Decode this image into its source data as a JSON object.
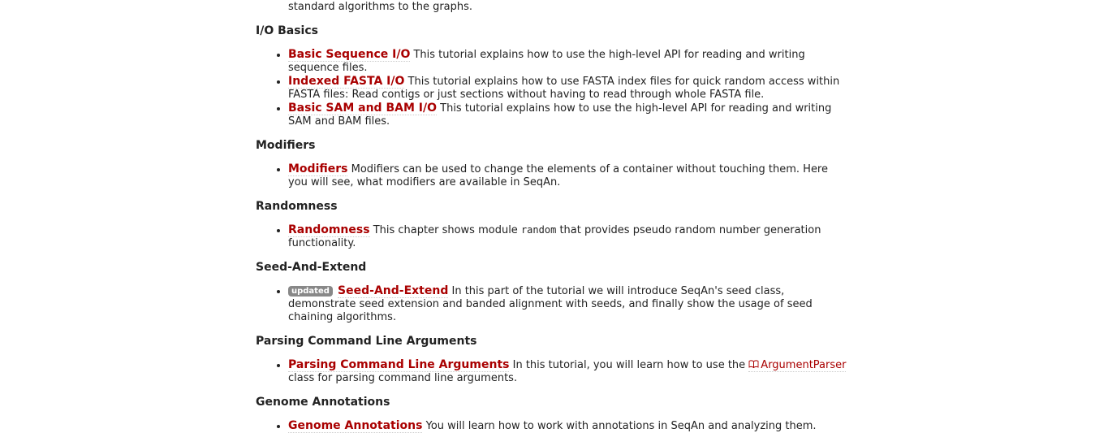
{
  "intro_text": "HMMs, how to store additional information for edges and vertices and last but not least how to apply standard algorithms to the graphs.",
  "sections": [
    {
      "heading": "I/O Basics",
      "items": [
        {
          "link": "Basic Sequence I/O",
          "text": "This tutorial explains how to use the high-level API for reading and writing sequence files."
        },
        {
          "link": "Indexed FASTA I/O",
          "text": "This tutorial explains how to use FASTA index files for quick random access within FASTA files: Read contigs or just sections without having to read through whole FASTA file."
        },
        {
          "link": "Basic SAM and BAM I/O",
          "text": "This tutorial explains how to use the high-level API for reading and writing SAM and BAM files."
        }
      ]
    },
    {
      "heading": "Modifiers",
      "items": [
        {
          "link": "Modifiers",
          "text": "Modifiers can be used to change the elements of a container without touching them. Here you will see, what modifiers are available in SeqAn."
        }
      ]
    },
    {
      "heading": "Randomness",
      "items": [
        {
          "link": "Randomness",
          "text_before": "This chapter shows module",
          "code": "random",
          "text_after": "that provides pseudo random number generation functionality."
        }
      ]
    },
    {
      "heading": "Seed-And-Extend",
      "items": [
        {
          "badge": "updated",
          "link": "Seed-And-Extend",
          "text": "In this part of the tutorial we will introduce SeqAn's seed class, demonstrate seed extension and banded alignment with seeds, and finally show the usage of seed chaining algorithms."
        }
      ]
    },
    {
      "heading": "Parsing Command Line Arguments",
      "items": [
        {
          "link": "Parsing Command Line Arguments",
          "text_before": "In this tutorial, you will learn how to use the",
          "class_ref": "ArgumentParser",
          "icon": "book-icon",
          "text_after": "class for parsing command line arguments."
        }
      ]
    },
    {
      "heading": "Genome Annotations",
      "items": [
        {
          "link": "Genome Annotations",
          "text": "You will learn how to work with annotations in SeqAn and analyzing them."
        }
      ]
    }
  ],
  "colors": {
    "link": "#a90000",
    "text": "#222222",
    "badge_bg": "#888888"
  }
}
